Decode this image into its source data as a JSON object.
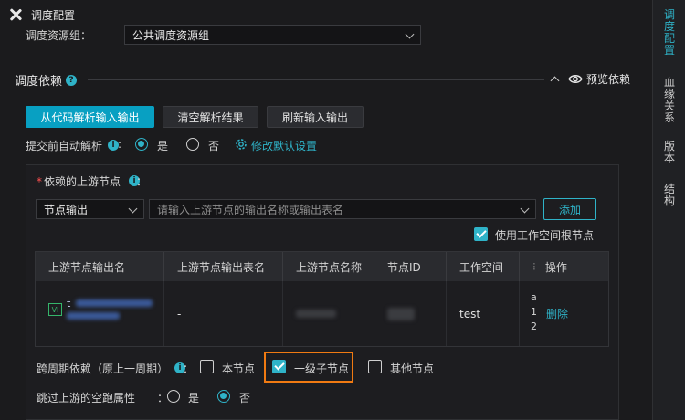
{
  "header": {
    "title": "调度配置"
  },
  "resource_group": {
    "label": "调度资源组：",
    "value": "公共调度资源组"
  },
  "dependency": {
    "title": "调度依赖",
    "preview_label": "预览依赖",
    "buttons": {
      "parse": "从代码解析输入输出",
      "clear": "清空解析结果",
      "refresh": "刷新输入输出"
    },
    "auto_parse": {
      "label": "提交前自动解析",
      "yes": "是",
      "no": "否",
      "selected": "是",
      "modify_link": "修改默认设置"
    }
  },
  "upstream": {
    "label": "依赖的上游节点",
    "colon": "：",
    "type_select": "节点输出",
    "search_placeholder": "请输入上游节点的输出名称或输出表名",
    "add_button": "添加",
    "use_root_label": "使用工作空间根节点",
    "use_root_checked": true,
    "table": {
      "columns": [
        "上游节点输出名",
        "上游节点输出表名",
        "上游节点名称",
        "节点ID",
        "工作空间",
        "操作"
      ],
      "rows": [
        {
          "badge": "VI",
          "output_name_prefix": "t",
          "output_table": "-",
          "node_name": "",
          "node_id": "",
          "workspace": "test",
          "ops_prefix": [
            "a",
            "1",
            "2"
          ],
          "delete_label": "删除"
        }
      ]
    }
  },
  "cross_cycle": {
    "label": "跨周期依赖（原上一周期）",
    "colon": "：",
    "options": [
      {
        "label": "本节点",
        "checked": false
      },
      {
        "label": "一级子节点",
        "checked": true
      },
      {
        "label": "其他节点",
        "checked": false
      }
    ]
  },
  "skip_dry_run": {
    "label": "跳过上游的空跑属性",
    "colon": "：",
    "yes": "是",
    "no": "否",
    "selected": "否"
  },
  "right_tabs": [
    {
      "label": "调度配置",
      "chars": [
        "调",
        "度",
        "配",
        "置"
      ],
      "active": true
    },
    {
      "label": "血缘关系",
      "chars": [
        "血",
        "缘",
        "关",
        "系"
      ],
      "active": false
    },
    {
      "label": "版本",
      "chars": [
        "版",
        "本"
      ],
      "active": false
    },
    {
      "label": "结构",
      "chars": [
        "结",
        "构"
      ],
      "active": false
    }
  ],
  "colors": {
    "accent": "#2fb3c8",
    "primary_button": "#08a0c2",
    "highlight": "#f07a12",
    "required": "#ff5050"
  }
}
